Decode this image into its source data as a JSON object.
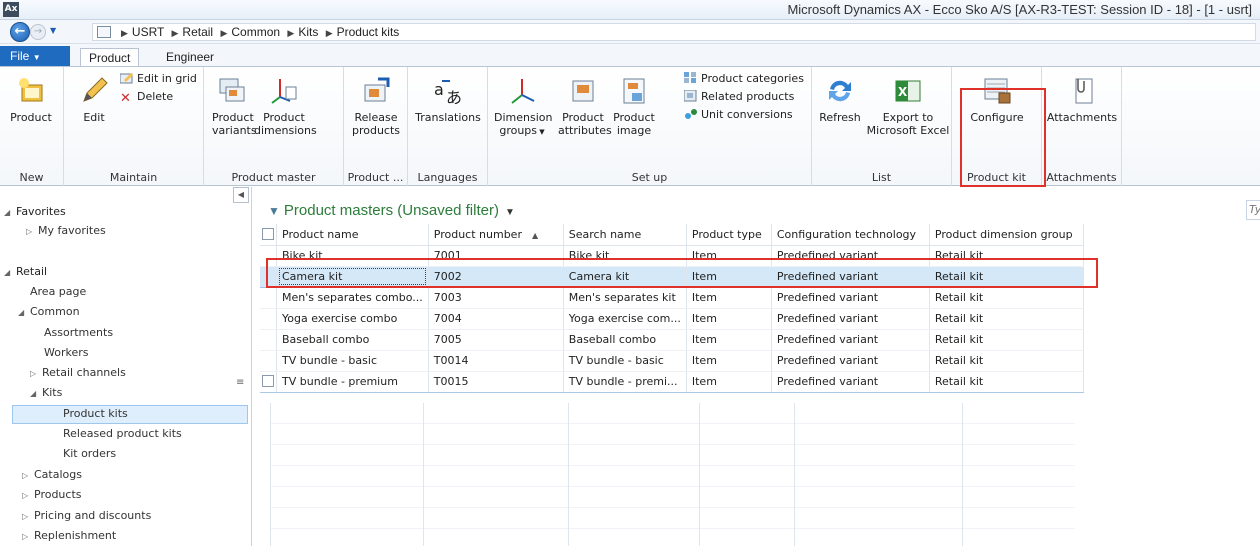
{
  "window": {
    "app_icon": "Ax",
    "title": "Microsoft Dynamics AX - Ecco Sko A/S [AX-R3-TEST: Session ID - 18] -  [1 - usrt]"
  },
  "address": {
    "breadcrumbs": [
      "USRT",
      "Retail",
      "Common",
      "Kits",
      "Product kits"
    ]
  },
  "ribbon_tabs": {
    "file": "File",
    "product": "Product",
    "engineer": "Engineer"
  },
  "ribbon": {
    "new": {
      "product": "Product",
      "group": "New"
    },
    "maintain": {
      "edit": "Edit",
      "edit_in_grid": "Edit in grid",
      "delete": "Delete",
      "group": "Maintain"
    },
    "product_master": {
      "variants_1": "Product",
      "variants_2": "variants",
      "dimensions_1": "Product",
      "dimensions_2": "dimensions",
      "group": "Product master"
    },
    "release": {
      "label_1": "Release",
      "label_2": "products",
      "group": "Product ..."
    },
    "languages": {
      "translations": "Translations",
      "group": "Languages"
    },
    "setup": {
      "dim_groups_1": "Dimension",
      "dim_groups_2": "groups",
      "attributes_1": "Product",
      "attributes_2": "attributes",
      "image_1": "Product",
      "image_2": "image",
      "categories": "Product categories",
      "related": "Related products",
      "unit_conversions": "Unit conversions",
      "group": "Set up"
    },
    "list": {
      "refresh": "Refresh",
      "export_1": "Export to",
      "export_2": "Microsoft Excel",
      "group": "List"
    },
    "product_kit": {
      "configure": "Configure",
      "group": "Product kit"
    },
    "attachments": {
      "attachments": "Attachments",
      "group": "Attachments"
    }
  },
  "nav": {
    "favorites": "Favorites",
    "my_favorites": "My favorites",
    "retail": "Retail",
    "area_page": "Area page",
    "common": "Common",
    "assortments": "Assortments",
    "workers": "Workers",
    "retail_channels": "Retail channels",
    "kits": "Kits",
    "product_kits": "Product kits",
    "released_product_kits": "Released product kits",
    "kit_orders": "Kit orders",
    "catalogs": "Catalogs",
    "products": "Products",
    "pricing": "Pricing and discounts",
    "replenishment": "Replenishment"
  },
  "grid": {
    "title": "Product masters (Unsaved filter)",
    "type_hint": "Ty",
    "columns": [
      "Product name",
      "Product number",
      "Search name",
      "Product type",
      "Configuration technology",
      "Product dimension group"
    ],
    "rows": [
      [
        "Bike kit",
        "7001",
        "Bike kit",
        "Item",
        "Predefined variant",
        "Retail kit"
      ],
      [
        "Camera kit",
        "7002",
        "Camera kit",
        "Item",
        "Predefined variant",
        "Retail kit"
      ],
      [
        "Men's separates combo...",
        "7003",
        "Men's separates kit",
        "Item",
        "Predefined variant",
        "Retail kit"
      ],
      [
        "Yoga exercise combo",
        "7004",
        "Yoga exercise com...",
        "Item",
        "Predefined variant",
        "Retail kit"
      ],
      [
        "Baseball combo",
        "7005",
        "Baseball combo",
        "Item",
        "Predefined variant",
        "Retail kit"
      ],
      [
        "TV bundle - basic",
        "T0014",
        "TV bundle - basic",
        "Item",
        "Predefined variant",
        "Retail kit"
      ],
      [
        "TV bundle - premium",
        "T0015",
        "TV bundle - premi...",
        "Item",
        "Predefined variant",
        "Retail kit"
      ]
    ]
  },
  "colors": {
    "accent": "#1e6bc0",
    "highlight_frame": "#e0302a",
    "grid_title": "#2c7c3a",
    "selected_row": "#d4e8f8"
  }
}
